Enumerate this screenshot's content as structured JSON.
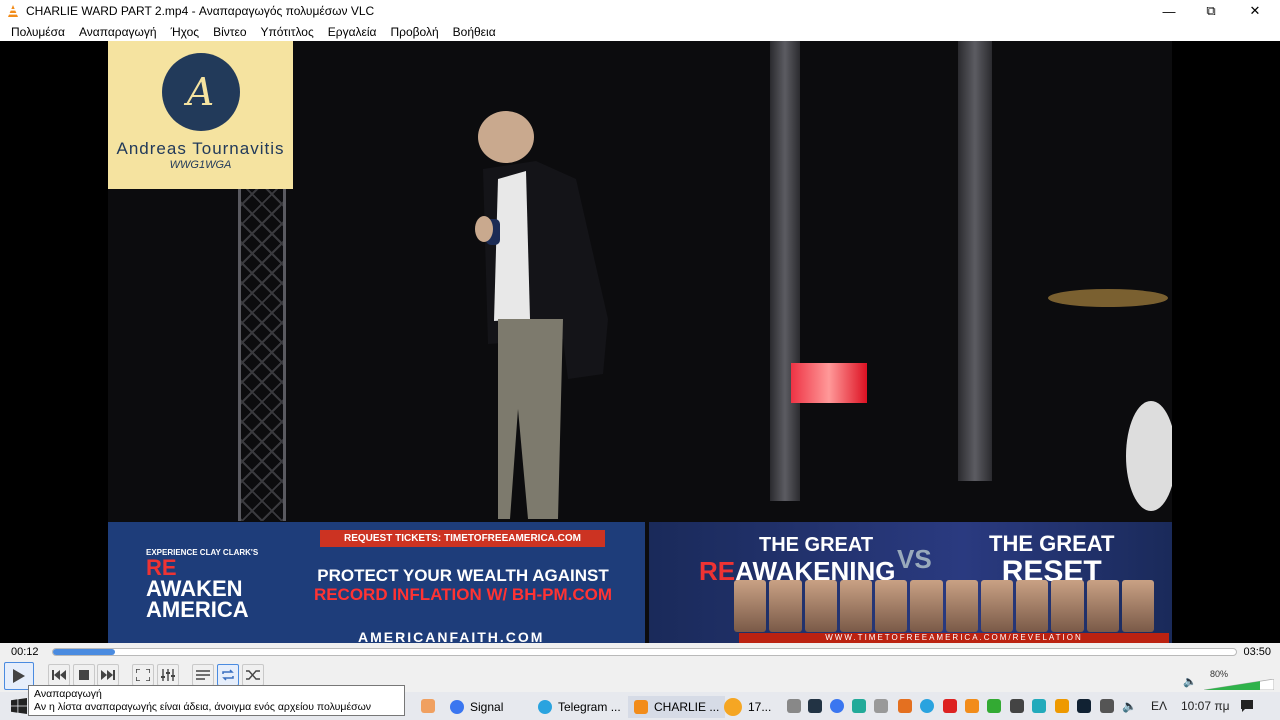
{
  "window": {
    "title": "CHARLIE WARD PART 2.mp4 - Αναπαραγωγός πολυμέσων VLC",
    "minimize": "—",
    "maximize": "⧉",
    "close": "✕"
  },
  "menu": [
    "Πολυμέσα",
    "Αναπαραγωγή",
    "Ήχος",
    "Βίντεο",
    "Υπότιτλος",
    "Εργαλεία",
    "Προβολή",
    "Βοήθεια"
  ],
  "video": {
    "logo_name": "Andreas Tournavitis",
    "logo_sub": "WWG1WGA",
    "logo_glyph": "A",
    "banner": {
      "tour_small": "EXPERIENCE CLAY CLARK'S",
      "tour_re": "RE",
      "tour_awaken": "AWAKEN",
      "tour_america": "AMERICA",
      "ticket": "REQUEST TICKETS: TIMETOFREEAMERICA.COM",
      "protect_line1": "PROTECT YOUR WEALTH AGAINST",
      "protect_line2": "RECORD INFLATION W/ BH-PM.COM",
      "af": "AMERICANFAITH.COM",
      "great_left_1": "THE GREAT",
      "great_left_re": "RE",
      "great_left_2": "AWAKENING",
      "vs": "VS",
      "great_right_1": "THE GREAT",
      "great_right_2": "RESET",
      "url_strip": "WWW.TIMETOFREEAMERICA.COM/REVELATION"
    }
  },
  "controls": {
    "time_current": "00:12",
    "time_total": "03:50",
    "progress": 0.052,
    "volume_label": "80%",
    "volume": 0.8
  },
  "tooltip": {
    "title": "Αναπαραγωγή",
    "text": "Αν η λίστα αναπαραγωγής είναι άδεια, άνοιγμα ενός αρχείου πολυμέσων"
  },
  "taskbar": {
    "signal": "Signal",
    "telegram": "Telegram ...",
    "charlie": "CHARLIE ...",
    "weather": "17...",
    "lang": "ΕΛ",
    "clock": "10:07 πμ"
  }
}
